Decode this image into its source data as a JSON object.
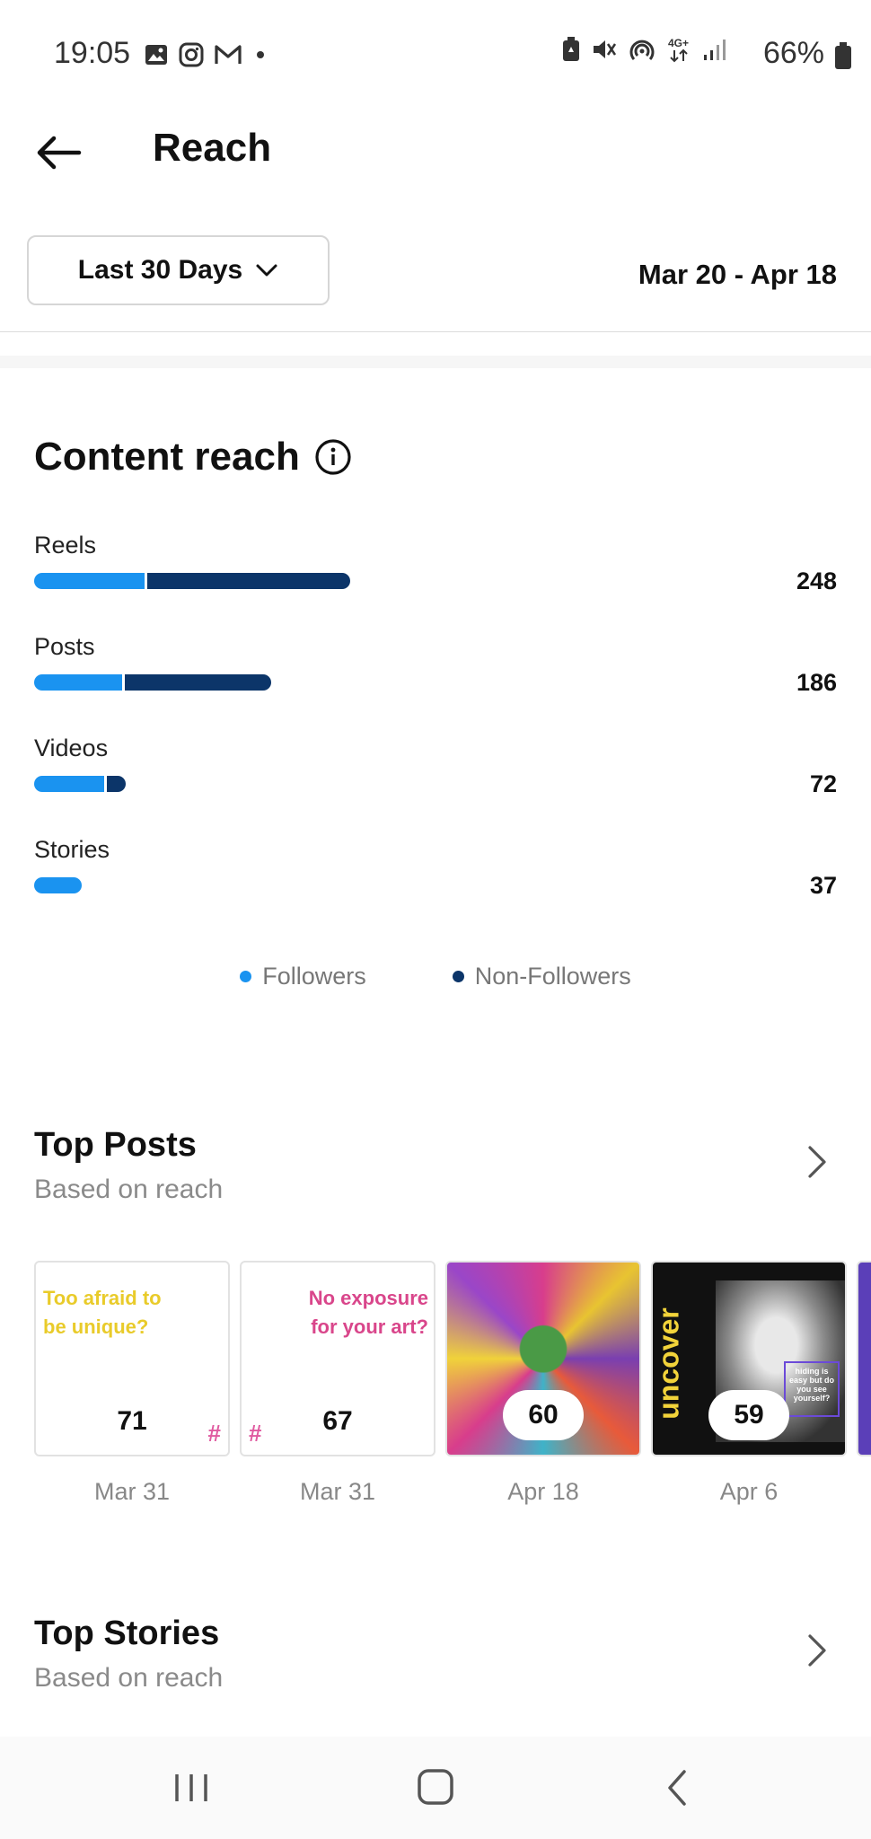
{
  "status_bar": {
    "time": "19:05",
    "left_icons": [
      "gallery-icon",
      "instagram-icon",
      "gmail-icon",
      "dot-icon"
    ],
    "right_icons": [
      "battery-saver-icon",
      "mute-icon",
      "hotspot-icon",
      "4g-icon",
      "signal-icon"
    ],
    "battery": "66%"
  },
  "header": {
    "title": "Reach",
    "range_button": "Last 30 Days",
    "date_range": "Mar 20 - Apr 18"
  },
  "content_reach": {
    "title": "Content reach",
    "rows": [
      {
        "label": "Reels",
        "value": "248",
        "followers_share": 0.35,
        "total": 248
      },
      {
        "label": "Posts",
        "value": "186",
        "followers_share": 0.37,
        "total": 186
      },
      {
        "label": "Videos",
        "value": "72",
        "followers_share": 0.76,
        "total": 72
      },
      {
        "label": "Stories",
        "value": "37",
        "followers_share": 1.0,
        "total": 37
      }
    ],
    "legend": {
      "followers": "Followers",
      "non_followers": "Non-Followers"
    },
    "colors": {
      "followers": "#1a93f0",
      "non_followers": "#0c3569"
    }
  },
  "top_posts": {
    "title": "Top Posts",
    "subtitle": "Based on reach",
    "items": [
      {
        "text": "Too afraid to be unique?",
        "value": "71",
        "date": "Mar 31"
      },
      {
        "text": "No exposure for your art?",
        "value": "67",
        "date": "Mar 31"
      },
      {
        "text": "",
        "value": "60",
        "date": "Apr 18"
      },
      {
        "text": "uncover",
        "caption": "hiding is easy but do you see yourself?",
        "value": "59",
        "date": "Apr 6"
      }
    ]
  },
  "top_stories": {
    "title": "Top Stories",
    "subtitle": "Based on reach"
  },
  "nav_bar": {
    "icons": [
      "recents-icon",
      "home-icon",
      "back-icon"
    ]
  }
}
